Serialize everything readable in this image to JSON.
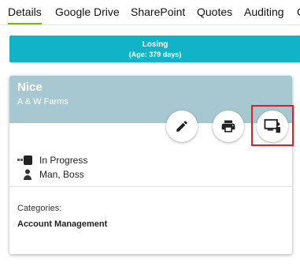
{
  "tabs": [
    {
      "label": "Details",
      "active": true
    },
    {
      "label": "Google Drive",
      "active": false
    },
    {
      "label": "SharePoint",
      "active": false
    },
    {
      "label": "Quotes",
      "active": false
    },
    {
      "label": "Auditing",
      "active": false
    },
    {
      "label": "C",
      "active": false
    }
  ],
  "status": {
    "label": "Losing",
    "age": "(Age: 379 days)",
    "color": "#12b3c8"
  },
  "card": {
    "title": "Nice",
    "subtitle": "A & W Farms",
    "header_color": "#a7c8d0",
    "actions": [
      {
        "icon": "pencil-icon"
      },
      {
        "icon": "printer-icon"
      },
      {
        "icon": "presentation-icon"
      }
    ],
    "stage": "In Progress",
    "owner": "Man, Boss",
    "categories_label": "Categories:",
    "category": "Account Management"
  },
  "highlight_color": "#e01e24"
}
